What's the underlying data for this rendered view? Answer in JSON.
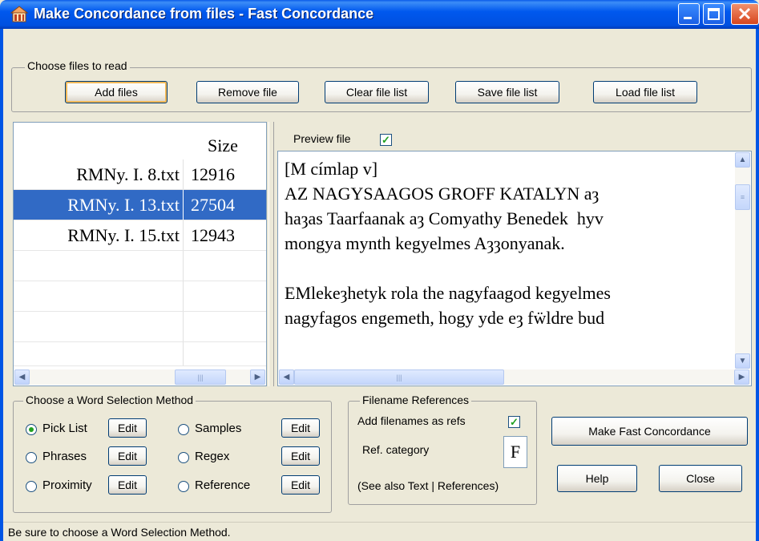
{
  "window": {
    "title": "Make Concordance from files - Fast Concordance"
  },
  "files_group": {
    "label": "Choose files to read",
    "add": "Add files",
    "remove": "Remove file",
    "clear": "Clear file list",
    "save": "Save file list",
    "load": "Load file list"
  },
  "file_list": {
    "size_header": "Size",
    "rows": [
      {
        "name": "RMNy. I. 8.txt",
        "size": "12916"
      },
      {
        "name": "RMNy. I. 13.txt",
        "size": "27504"
      },
      {
        "name": "RMNy. I. 15.txt",
        "size": "12943"
      }
    ],
    "selected_index": 1
  },
  "preview": {
    "label": "Preview file",
    "checked": true,
    "lines": [
      "[M címlap v]",
      "AZ NAGYSAAGOS GROFF KATALYN aȝ",
      "haȝas Taarfaanak aȝ Comyathy Benedek  hyv",
      "mongya mynth kegyelmes Aȝȝonyanak.",
      "",
      "EMlekeȝhetyk rola the nagyfaagod kegyelmes",
      "nagyfagos engemeth, hogy yde eȝ fẅldre bud"
    ]
  },
  "word_selection": {
    "label": "Choose a  Word Selection Method",
    "options": [
      "Pick List",
      "Phrases",
      "Proximity",
      "Samples",
      "Regex",
      "Reference"
    ],
    "edit": "Edit",
    "selected": "Pick List"
  },
  "filename_refs": {
    "label": "Filename References",
    "add_label": "Add filenames as refs",
    "add_checked": true,
    "category_label": "Ref. category",
    "category_value": "F",
    "see_also": "(See also Text | References)"
  },
  "actions": {
    "make": "Make Fast Concordance",
    "help": "Help",
    "close": "Close"
  },
  "status": "Be sure to choose a Word Selection Method.",
  "icons": {
    "app": "concordance-app-icon",
    "minimize": "minimize-icon",
    "maximize": "maximize-icon",
    "close": "close-icon"
  }
}
